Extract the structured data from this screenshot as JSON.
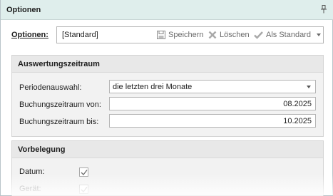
{
  "panel": {
    "title": "Optionen",
    "pin_icon": "pin-icon"
  },
  "options": {
    "label": "Optionen:",
    "value": "[Standard]",
    "save_label": "Speichern",
    "delete_label": "Löschen",
    "default_label": "Als Standard"
  },
  "evaluation": {
    "heading": "Auswertungszeitraum",
    "period_label": "Periodenauswahl:",
    "period_value": "die letzten drei Monate",
    "from_label": "Buchungszeitraum von:",
    "from_value": "08.2025",
    "to_label": "Buchungszeitraum bis:",
    "to_value": "10.2025"
  },
  "preset": {
    "heading": "Vorbelegung",
    "date_label": "Datum:",
    "date_checked": true,
    "device_label": "Gerät:",
    "device_checked": true,
    "device_disabled": true
  }
}
